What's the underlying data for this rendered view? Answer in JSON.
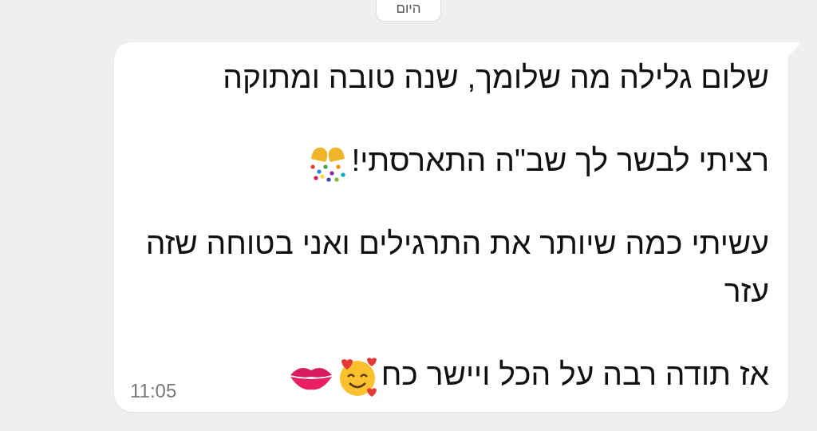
{
  "date_chip": "היום",
  "message": {
    "paragraphs": [
      {
        "text": "שלום גלילה מה שלומך, שנה טובה ומתוקה"
      },
      {
        "text": "רציתי לבשר לך שב\"ה התארסתי!",
        "emoji": [
          {
            "kind": "confetti"
          }
        ]
      },
      {
        "text": "עשיתי כמה שיותר את התרגילים ואני בטוחה שזה עזר"
      },
      {
        "text": "אז תודה רבה על הכל ויישר כח",
        "emoji": [
          {
            "kind": "smiling-hearts"
          },
          {
            "kind": "kiss"
          }
        ]
      }
    ],
    "time": "11:05"
  }
}
